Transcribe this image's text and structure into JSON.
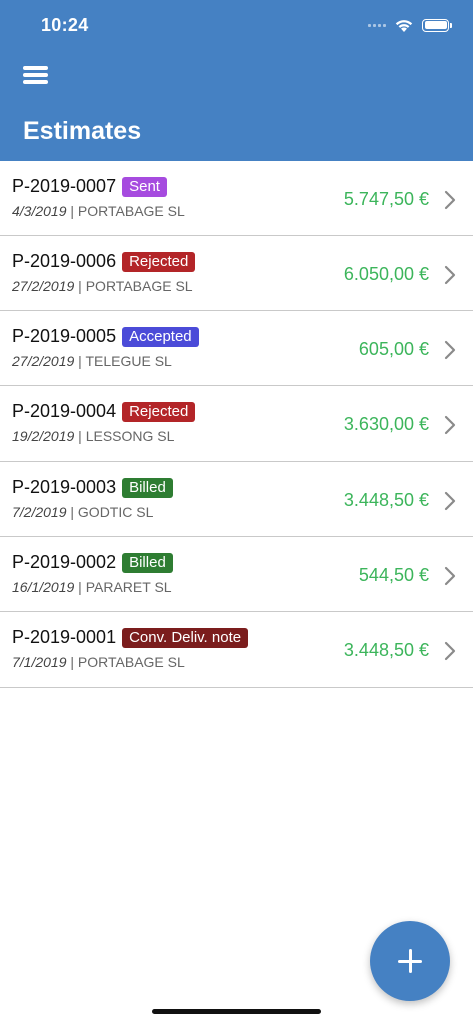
{
  "status_bar": {
    "time": "10:24"
  },
  "header": {
    "title": "Estimates"
  },
  "colors": {
    "header_bg": "#4581c3",
    "amount_text": "#3cb55b",
    "badge_sent": "#a64bdf",
    "badge_rejected": "#b32528",
    "badge_accepted": "#4b4bd8",
    "badge_billed": "#2e7d32",
    "badge_conv_deliv_note": "#7b1d1d"
  },
  "estimates": [
    {
      "code": "P-2019-0007",
      "status": "Sent",
      "status_color": "#a64bdf",
      "date": "4/3/2019",
      "client": "PORTABAGE SL",
      "amount": "5.747,50 €"
    },
    {
      "code": "P-2019-0006",
      "status": "Rejected",
      "status_color": "#b32528",
      "date": "27/2/2019",
      "client": "PORTABAGE SL",
      "amount": "6.050,00 €"
    },
    {
      "code": "P-2019-0005",
      "status": "Accepted",
      "status_color": "#4b4bd8",
      "date": "27/2/2019",
      "client": "TELEGUE SL",
      "amount": "605,00 €"
    },
    {
      "code": "P-2019-0004",
      "status": "Rejected",
      "status_color": "#b32528",
      "date": "19/2/2019",
      "client": "LESSONG SL",
      "amount": "3.630,00 €"
    },
    {
      "code": "P-2019-0003",
      "status": "Billed",
      "status_color": "#2e7d32",
      "date": "7/2/2019",
      "client": "GODTIC SL",
      "amount": "3.448,50 €"
    },
    {
      "code": "P-2019-0002",
      "status": "Billed",
      "status_color": "#2e7d32",
      "date": "16/1/2019",
      "client": "PARARET SL",
      "amount": "544,50 €"
    },
    {
      "code": "P-2019-0001",
      "status": "Conv. Deliv. note",
      "status_color": "#7b1d1d",
      "date": "7/1/2019",
      "client": "PORTABAGE SL",
      "amount": "3.448,50 €"
    }
  ],
  "icons": {
    "menu": "menu-icon",
    "chevron": "chevron-right-icon",
    "add": "plus-icon",
    "wifi": "wifi-icon",
    "battery": "battery-icon",
    "signal": "signal-icon"
  }
}
